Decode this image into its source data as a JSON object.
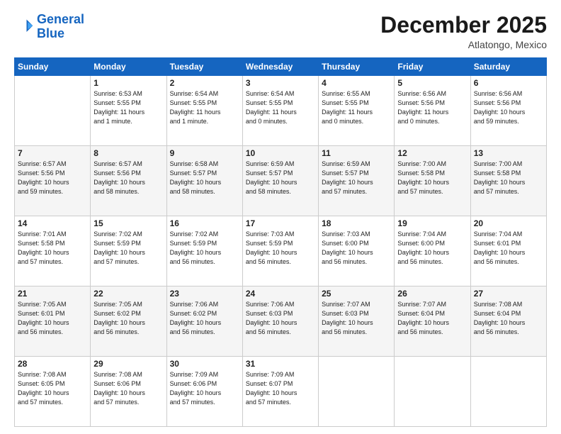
{
  "header": {
    "logo_line1": "General",
    "logo_line2": "Blue",
    "month": "December 2025",
    "location": "Atlatongo, Mexico"
  },
  "days_of_week": [
    "Sunday",
    "Monday",
    "Tuesday",
    "Wednesday",
    "Thursday",
    "Friday",
    "Saturday"
  ],
  "weeks": [
    [
      {
        "day": "",
        "info": ""
      },
      {
        "day": "1",
        "info": "Sunrise: 6:53 AM\nSunset: 5:55 PM\nDaylight: 11 hours\nand 1 minute."
      },
      {
        "day": "2",
        "info": "Sunrise: 6:54 AM\nSunset: 5:55 PM\nDaylight: 11 hours\nand 1 minute."
      },
      {
        "day": "3",
        "info": "Sunrise: 6:54 AM\nSunset: 5:55 PM\nDaylight: 11 hours\nand 0 minutes."
      },
      {
        "day": "4",
        "info": "Sunrise: 6:55 AM\nSunset: 5:55 PM\nDaylight: 11 hours\nand 0 minutes."
      },
      {
        "day": "5",
        "info": "Sunrise: 6:56 AM\nSunset: 5:56 PM\nDaylight: 11 hours\nand 0 minutes."
      },
      {
        "day": "6",
        "info": "Sunrise: 6:56 AM\nSunset: 5:56 PM\nDaylight: 10 hours\nand 59 minutes."
      }
    ],
    [
      {
        "day": "7",
        "info": "Sunrise: 6:57 AM\nSunset: 5:56 PM\nDaylight: 10 hours\nand 59 minutes."
      },
      {
        "day": "8",
        "info": "Sunrise: 6:57 AM\nSunset: 5:56 PM\nDaylight: 10 hours\nand 58 minutes."
      },
      {
        "day": "9",
        "info": "Sunrise: 6:58 AM\nSunset: 5:57 PM\nDaylight: 10 hours\nand 58 minutes."
      },
      {
        "day": "10",
        "info": "Sunrise: 6:59 AM\nSunset: 5:57 PM\nDaylight: 10 hours\nand 58 minutes."
      },
      {
        "day": "11",
        "info": "Sunrise: 6:59 AM\nSunset: 5:57 PM\nDaylight: 10 hours\nand 57 minutes."
      },
      {
        "day": "12",
        "info": "Sunrise: 7:00 AM\nSunset: 5:58 PM\nDaylight: 10 hours\nand 57 minutes."
      },
      {
        "day": "13",
        "info": "Sunrise: 7:00 AM\nSunset: 5:58 PM\nDaylight: 10 hours\nand 57 minutes."
      }
    ],
    [
      {
        "day": "14",
        "info": "Sunrise: 7:01 AM\nSunset: 5:58 PM\nDaylight: 10 hours\nand 57 minutes."
      },
      {
        "day": "15",
        "info": "Sunrise: 7:02 AM\nSunset: 5:59 PM\nDaylight: 10 hours\nand 57 minutes."
      },
      {
        "day": "16",
        "info": "Sunrise: 7:02 AM\nSunset: 5:59 PM\nDaylight: 10 hours\nand 56 minutes."
      },
      {
        "day": "17",
        "info": "Sunrise: 7:03 AM\nSunset: 5:59 PM\nDaylight: 10 hours\nand 56 minutes."
      },
      {
        "day": "18",
        "info": "Sunrise: 7:03 AM\nSunset: 6:00 PM\nDaylight: 10 hours\nand 56 minutes."
      },
      {
        "day": "19",
        "info": "Sunrise: 7:04 AM\nSunset: 6:00 PM\nDaylight: 10 hours\nand 56 minutes."
      },
      {
        "day": "20",
        "info": "Sunrise: 7:04 AM\nSunset: 6:01 PM\nDaylight: 10 hours\nand 56 minutes."
      }
    ],
    [
      {
        "day": "21",
        "info": "Sunrise: 7:05 AM\nSunset: 6:01 PM\nDaylight: 10 hours\nand 56 minutes."
      },
      {
        "day": "22",
        "info": "Sunrise: 7:05 AM\nSunset: 6:02 PM\nDaylight: 10 hours\nand 56 minutes."
      },
      {
        "day": "23",
        "info": "Sunrise: 7:06 AM\nSunset: 6:02 PM\nDaylight: 10 hours\nand 56 minutes."
      },
      {
        "day": "24",
        "info": "Sunrise: 7:06 AM\nSunset: 6:03 PM\nDaylight: 10 hours\nand 56 minutes."
      },
      {
        "day": "25",
        "info": "Sunrise: 7:07 AM\nSunset: 6:03 PM\nDaylight: 10 hours\nand 56 minutes."
      },
      {
        "day": "26",
        "info": "Sunrise: 7:07 AM\nSunset: 6:04 PM\nDaylight: 10 hours\nand 56 minutes."
      },
      {
        "day": "27",
        "info": "Sunrise: 7:08 AM\nSunset: 6:04 PM\nDaylight: 10 hours\nand 56 minutes."
      }
    ],
    [
      {
        "day": "28",
        "info": "Sunrise: 7:08 AM\nSunset: 6:05 PM\nDaylight: 10 hours\nand 57 minutes."
      },
      {
        "day": "29",
        "info": "Sunrise: 7:08 AM\nSunset: 6:06 PM\nDaylight: 10 hours\nand 57 minutes."
      },
      {
        "day": "30",
        "info": "Sunrise: 7:09 AM\nSunset: 6:06 PM\nDaylight: 10 hours\nand 57 minutes."
      },
      {
        "day": "31",
        "info": "Sunrise: 7:09 AM\nSunset: 6:07 PM\nDaylight: 10 hours\nand 57 minutes."
      },
      {
        "day": "",
        "info": ""
      },
      {
        "day": "",
        "info": ""
      },
      {
        "day": "",
        "info": ""
      }
    ]
  ]
}
